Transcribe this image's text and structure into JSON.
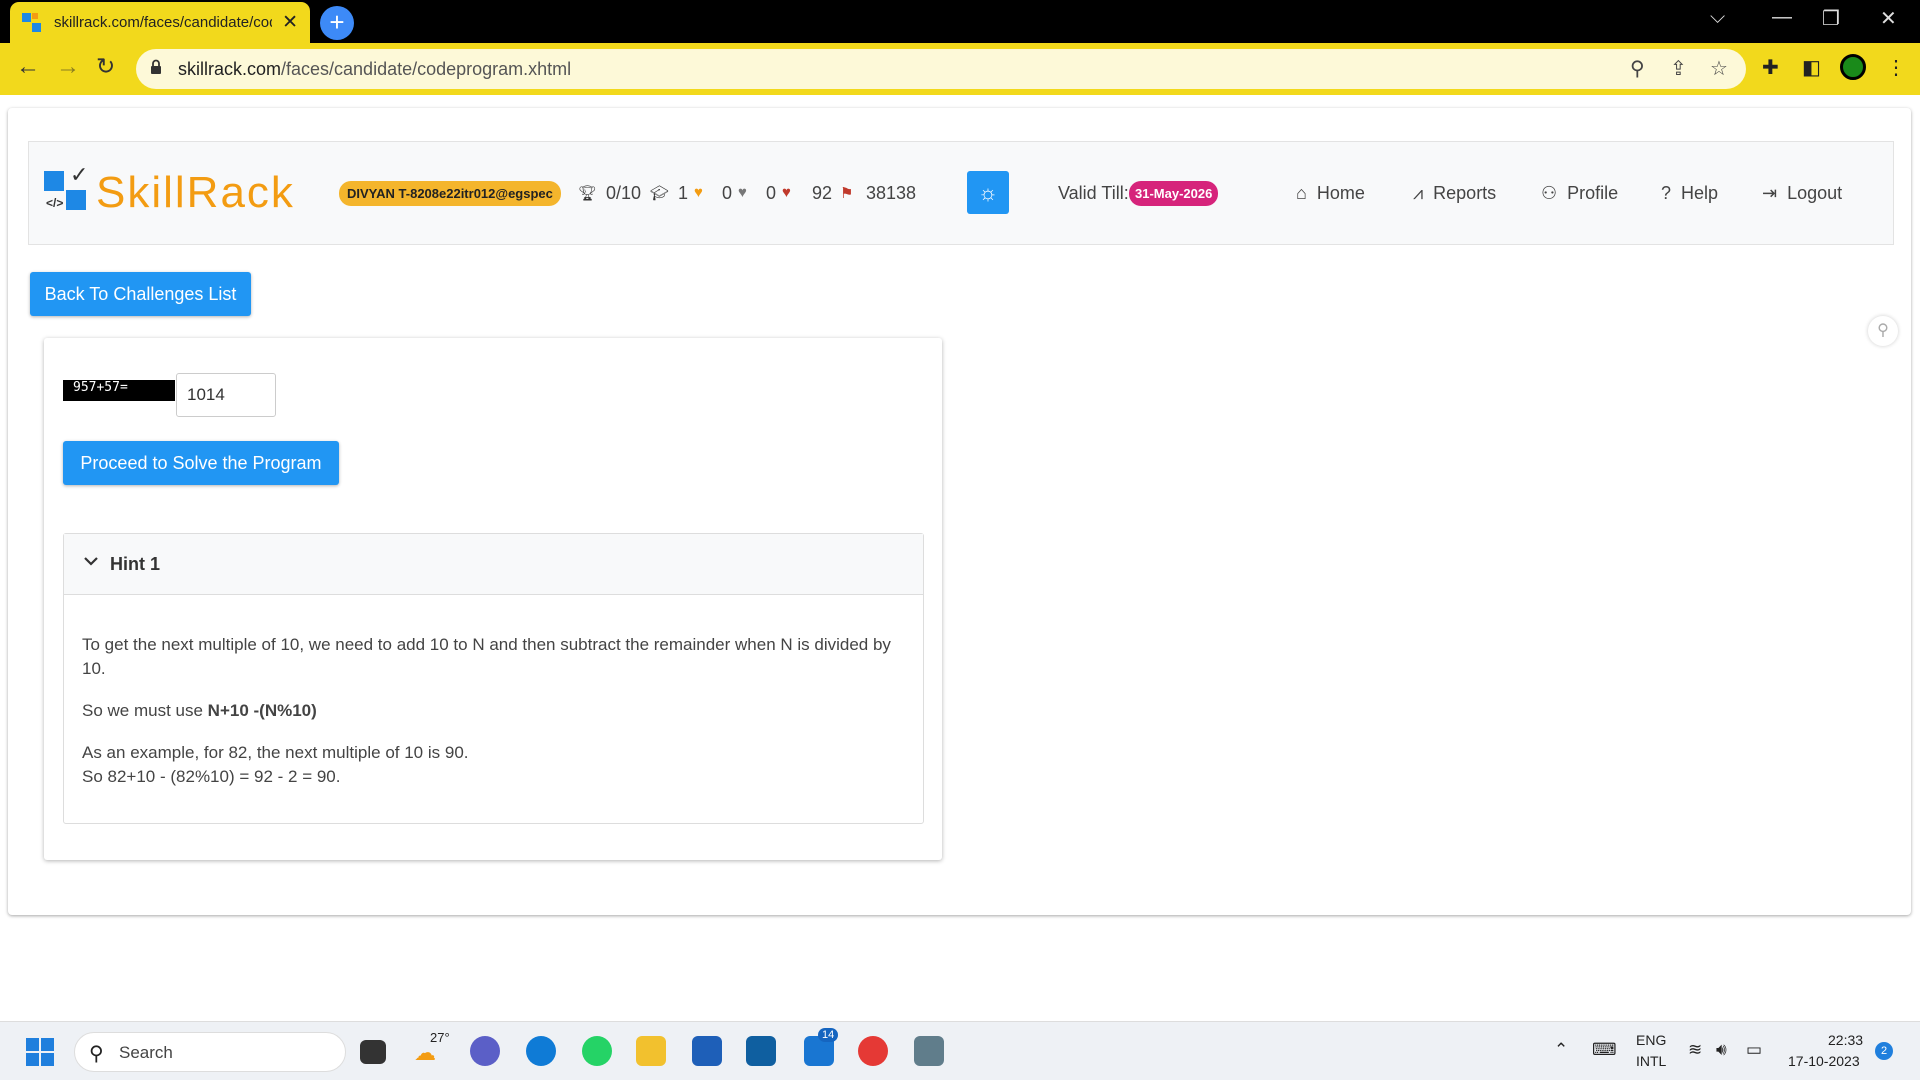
{
  "browser": {
    "tab_title": "skillrack.com/faces/candidate/codeprogram.xhtml",
    "close": "✕",
    "new_tab": "+",
    "url_domain": "skillrack.com",
    "url_path": "/faces/candidate/codeprogram.xhtml",
    "win_min": "—",
    "win_restore": "❐",
    "win_close": "✕",
    "win_chevron": "⌵"
  },
  "header": {
    "logo_text": "SkillRack",
    "logo_code": "</>",
    "user": "DIVYAN T-8208e22itr012@egspec",
    "stats": {
      "programs": "0/10",
      "certificates": "1",
      "gold": "0",
      "silver": "0",
      "bronze": "92",
      "points": "38138"
    },
    "valid_label": "Valid Till:",
    "valid_date": "31-May-2026",
    "nav": [
      "Home",
      "Reports",
      "Profile",
      "Help",
      "Logout"
    ]
  },
  "back_button": "Back To Challenges List",
  "captcha": {
    "question": "957+57=",
    "answer": "1014"
  },
  "proceed_button": "Proceed to Solve the Program",
  "hint": {
    "title": "Hint 1",
    "p1": "To get the next multiple of 10, we need to add 10 to N and then subtract the remainder when N is divided by 10.",
    "p2_prefix": "So we must use ",
    "p2_formula": "N+10 -(N%10)",
    "p3_line1": "As an example, for 82, the next multiple of 10 is 90.",
    "p3_line2": "So 82+10 - (82%10) = 92 - 2 = 90."
  },
  "taskbar": {
    "search": "Search",
    "weather": "27°",
    "mail_badge": "14",
    "lang1": "ENG",
    "lang2": "INTL",
    "time": "22:33",
    "date": "17-10-2023",
    "notif": "2"
  },
  "colors": {
    "accent": "#2196f3",
    "browser_theme": "#f2d91c",
    "badge_user": "#f4b52c",
    "badge_date": "#d6247b"
  }
}
